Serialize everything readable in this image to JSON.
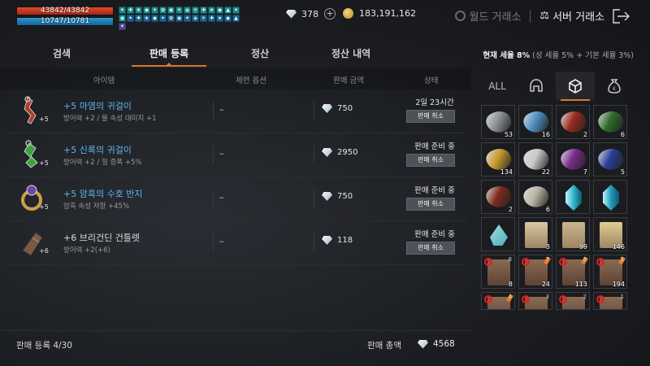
{
  "player": {
    "hp_text": "43842/43842",
    "hp_ratio": 1.0,
    "mp_text": "10747/10781",
    "mp_ratio": 0.997
  },
  "currency": {
    "diamonds": "378",
    "gold": "183,191,162"
  },
  "nav": {
    "world_market": "월드 거래소",
    "server_market": "서버 거래소"
  },
  "tabs": [
    {
      "label": "검색"
    },
    {
      "label": "판매 등록",
      "active": true
    },
    {
      "label": "정산"
    },
    {
      "label": "정산 내역"
    }
  ],
  "tax": {
    "current": "현재 세율 8%",
    "detail": "(성 세율 5% + 기본 세율 3%)"
  },
  "table": {
    "headers": [
      "아이템",
      "제련 옵션",
      "판매 금액",
      "상태"
    ],
    "rows": [
      {
        "level": "+5",
        "name": "+5 마염의 귀걸이",
        "desc": "방어력 +2 / 불 속성 대미지 +1",
        "refine": "–",
        "price": "750",
        "status": "2일 23시간",
        "action": "판매 취소",
        "rarity": "blue"
      },
      {
        "level": "+5",
        "name": "+5 신록의 귀걸이",
        "desc": "방어력 +2 / 힐 증폭 +5%",
        "refine": "–",
        "price": "2950",
        "status": "판매 준비 중",
        "action": "판매 취소",
        "rarity": "blue"
      },
      {
        "level": "+5",
        "name": "+5 암흑의 수호 반지",
        "desc": "암흑 속성 저항 +45%",
        "refine": "–",
        "price": "750",
        "status": "판매 준비 중",
        "action": "판매 취소",
        "rarity": "blue"
      },
      {
        "level": "+6",
        "name": "+6 브리건딘 건틀렛",
        "desc": "방어력 +2(+6)",
        "refine": "–",
        "price": "118",
        "status": "판매 준비 중",
        "action": "판매 취소",
        "rarity": "normal"
      }
    ]
  },
  "footer": {
    "count": "판매 등록 4/30",
    "total_label": "판매 총액",
    "total": "4568"
  },
  "inventory": {
    "categories": [
      {
        "label": "ALL"
      },
      {
        "icon": "helmet-icon"
      },
      {
        "icon": "box-icon",
        "active": true
      },
      {
        "icon": "money-bag-icon"
      }
    ],
    "slots": [
      {
        "kind": "plate",
        "color": "#8c8f93",
        "qty": "53"
      },
      {
        "kind": "plate",
        "color": "#4d8fc0",
        "qty": "16"
      },
      {
        "kind": "plate",
        "color": "#9a2a1c",
        "qty": "2"
      },
      {
        "kind": "plate",
        "color": "#2f6a2a",
        "qty": "6"
      },
      {
        "kind": "plate",
        "color": "#c79a2a",
        "qty": "134"
      },
      {
        "kind": "plate",
        "color": "#c9c9c9",
        "qty": "22"
      },
      {
        "kind": "plate",
        "color": "#7a2a8a",
        "qty": "7"
      },
      {
        "kind": "plate",
        "color": "#2a3c9a",
        "qty": "5"
      },
      {
        "kind": "plate",
        "color": "#7d2a1c",
        "qty": "2"
      },
      {
        "kind": "plate",
        "color": "#b9b5a5",
        "qty": "6"
      },
      {
        "kind": "gem",
        "color": "#2fb6c9",
        "qty": ""
      },
      {
        "kind": "gem",
        "color": "#1f9ab8",
        "qty": ""
      },
      {
        "kind": "crystal",
        "color": "#4fa9b5",
        "qty": ""
      },
      {
        "kind": "scroll",
        "color": "#d8c7a2",
        "qty": "3"
      },
      {
        "kind": "scroll",
        "color": "#c9b48e",
        "qty": "99"
      },
      {
        "kind": "scroll",
        "color": "#e2cd8e",
        "qty": "146"
      },
      {
        "kind": "scroll-dark",
        "color": "#8a6b54",
        "qty": "8",
        "rq": "8",
        "locked": true,
        "pinned": false
      },
      {
        "kind": "scroll-dark",
        "color": "#8a6b54",
        "qty": "24",
        "rq": "7",
        "locked": true,
        "pinned": true
      },
      {
        "kind": "scroll-dark",
        "color": "#8a6b54",
        "qty": "113",
        "rq": "6",
        "locked": true,
        "pinned": true
      },
      {
        "kind": "scroll-dark",
        "color": "#8a6b54",
        "qty": "194",
        "rq": "5",
        "locked": true,
        "pinned": true
      },
      {
        "kind": "scroll-dark",
        "color": "#8a6b54",
        "qty": "",
        "rq": "4",
        "locked": true,
        "pinned": true,
        "half": true
      },
      {
        "kind": "scroll-dark",
        "color": "#8a6b54",
        "qty": "",
        "rq": "3",
        "locked": true,
        "pinned": false,
        "half": true
      },
      {
        "kind": "scroll-dark",
        "color": "#8a6b54",
        "qty": "",
        "rq": "2",
        "locked": true,
        "pinned": false,
        "half": true
      },
      {
        "kind": "scroll-dark",
        "color": "#8a6b54",
        "qty": "",
        "rq": "1",
        "locked": true,
        "pinned": false,
        "half": true
      }
    ]
  },
  "colors": {
    "accent": "#d9772b",
    "rare_text": "#5fb3f0"
  }
}
